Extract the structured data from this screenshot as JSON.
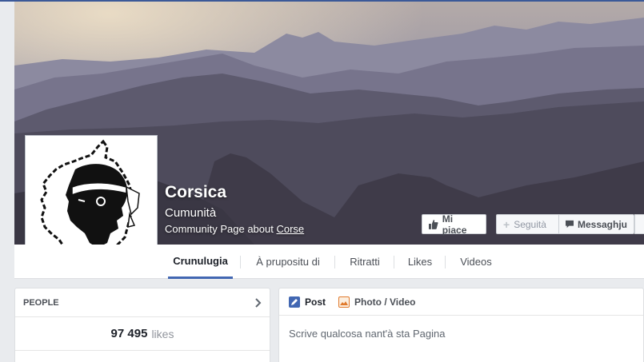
{
  "header": {
    "page_name": "Corsica",
    "category": "Cumunità",
    "community_text": "Community Page about",
    "community_link": "Corse"
  },
  "actions": {
    "like_label": "Mi piace",
    "follow_label": "Seguità",
    "message_label": "Messaghju"
  },
  "tabs": [
    {
      "label": "Crunulugia",
      "active": true
    },
    {
      "label": "À prupositu di",
      "active": false
    },
    {
      "label": "Ritratti",
      "active": false
    },
    {
      "label": "Likes",
      "active": false
    },
    {
      "label": "Videos",
      "active": false
    }
  ],
  "people": {
    "title": "PEOPLE",
    "likes_count": "97 495",
    "likes_word": "likes"
  },
  "composer": {
    "post_label": "Post",
    "photo_label": "Photo / Video",
    "placeholder": "Scrive qualcosa nant'à sta Pagina"
  },
  "colors": {
    "accent": "#4267b2",
    "background": "#e9ebee"
  },
  "icons": {
    "like": "thumbs-up-icon",
    "follow": "plus-icon",
    "message": "speech-bubble-icon",
    "people_more": "chevron-right-icon",
    "post": "pencil-icon",
    "photo": "photo-icon"
  }
}
